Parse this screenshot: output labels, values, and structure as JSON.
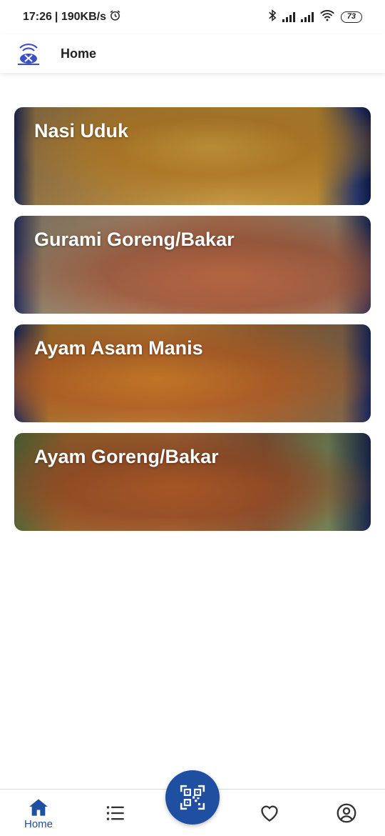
{
  "status_bar": {
    "time": "17:26",
    "network_speed": "| 190KB/s",
    "battery": "73"
  },
  "app_bar": {
    "title": "Home"
  },
  "menu": {
    "items": [
      {
        "label": "Nasi Uduk"
      },
      {
        "label": "Gurami Goreng/Bakar"
      },
      {
        "label": "Ayam Asam Manis"
      },
      {
        "label": "Ayam Goreng/Bakar"
      }
    ]
  },
  "bottom_nav": {
    "home_label": "Home",
    "active_color": "#1e4fa0",
    "icons": [
      "home-icon",
      "list-icon",
      "qr-code-icon",
      "heart-icon",
      "profile-icon"
    ]
  }
}
